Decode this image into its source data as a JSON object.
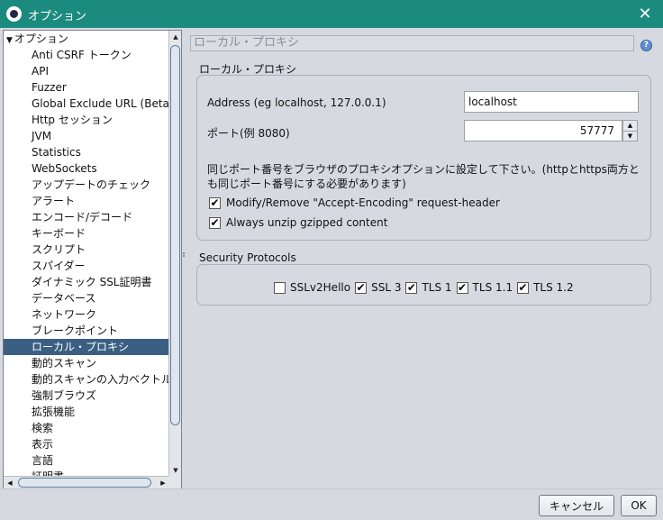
{
  "window": {
    "title": "オプション"
  },
  "tree": {
    "root_label": "オプション",
    "items": [
      "Anti CSRF トークン",
      "API",
      "Fuzzer",
      "Global Exclude URL (Beta)",
      "Http セッション",
      "JVM",
      "Statistics",
      "WebSockets",
      "アップデートのチェック",
      "アラート",
      "エンコード/デコード",
      "キーボード",
      "スクリプト",
      "スパイダー",
      "ダイナミック SSL証明書",
      "データベース",
      "ネットワーク",
      "ブレークポイント",
      "ローカル・プロキシ",
      "動的スキャン",
      "動的スキャンの入力ベクトル",
      "強制ブラウズ",
      "拡張機能",
      "検索",
      "表示",
      "言語",
      "証明書"
    ],
    "selected_index": 18
  },
  "panel": {
    "header_title": "ローカル・プロキシ",
    "proxy_group": {
      "label": "ローカル・プロキシ",
      "address_label": "Address (eg localhost, 127.0.0.1)",
      "address_value": "localhost",
      "port_label": "ポート(例 8080)",
      "port_value": "57777",
      "note_line1": "同じポート番号をブラウザのプロキシオプションに設定して下さい。(httpとhttps両方と",
      "note_line2": "も同じポート番号にする必要があります)",
      "options": [
        {
          "label": "Modify/Remove \"Accept-Encoding\" request-header",
          "checked": true
        },
        {
          "label": "Always unzip gzipped content",
          "checked": true
        }
      ]
    },
    "security_group": {
      "label": "Security Protocols",
      "protocols": [
        {
          "label": "SSLv2Hello",
          "checked": false
        },
        {
          "label": "SSL 3",
          "checked": true
        },
        {
          "label": "TLS 1",
          "checked": true
        },
        {
          "label": "TLS 1.1",
          "checked": true
        },
        {
          "label": "TLS 1.2",
          "checked": true
        }
      ]
    }
  },
  "buttons": {
    "cancel": "キャンセル",
    "ok": "OK"
  },
  "icons": {
    "app": "app-logo-icon",
    "close": "close-icon",
    "help": "help-icon"
  },
  "colors": {
    "titlebar": "#1b8b7f",
    "selection": "#3a5f82"
  }
}
